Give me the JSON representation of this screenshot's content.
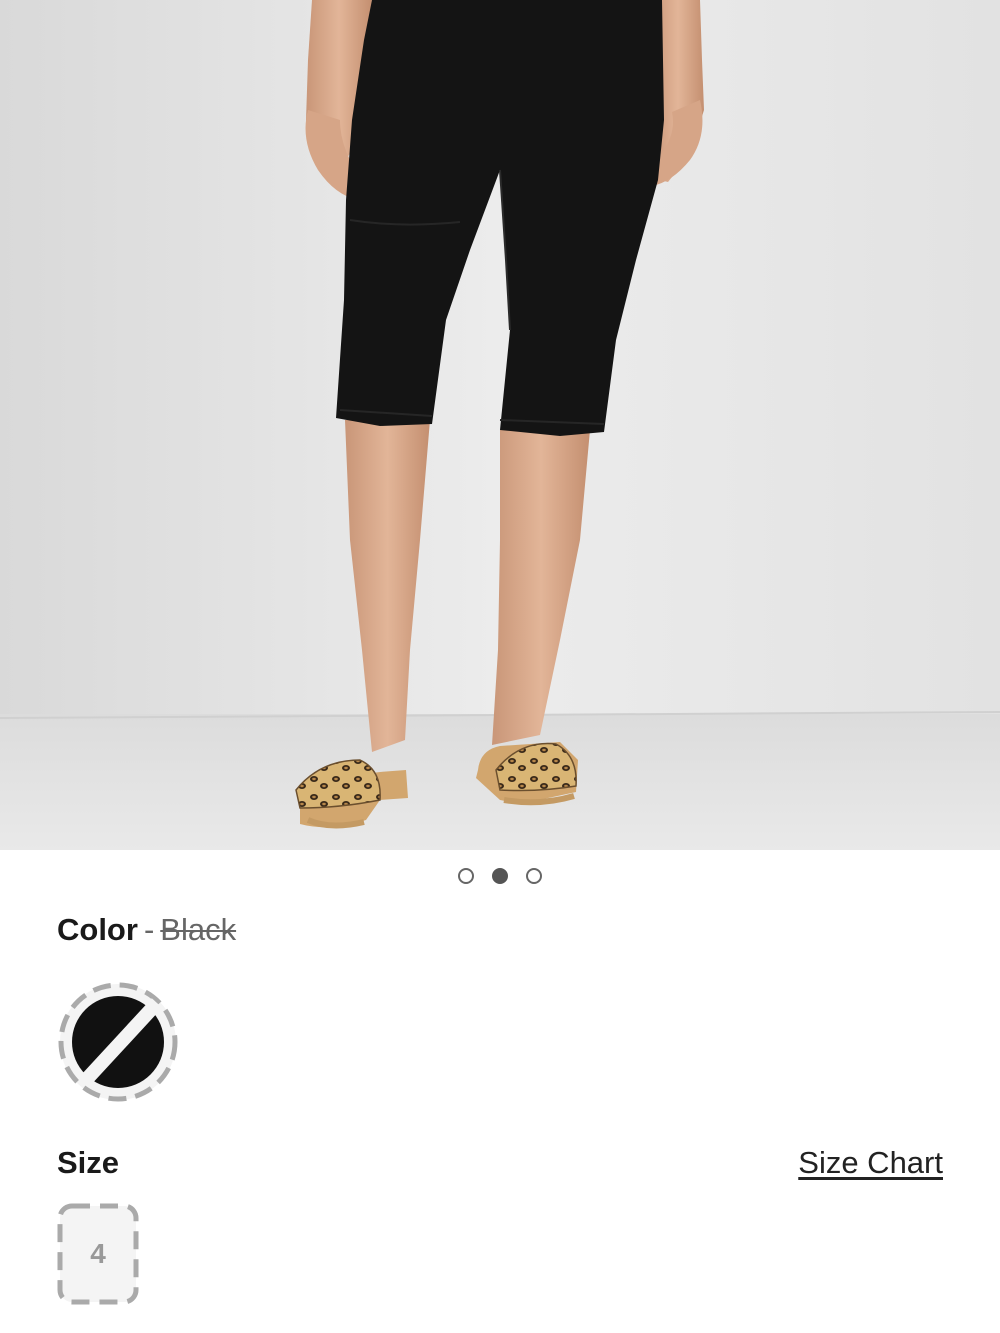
{
  "product_image": {
    "alt": "Woman wearing black capri pants with leopard print sandals"
  },
  "carousel": {
    "dots": [
      {
        "active": false
      },
      {
        "active": true
      },
      {
        "active": false
      }
    ]
  },
  "color": {
    "label": "Color",
    "separator": "-",
    "selected_value": "Black",
    "status": "unavailable",
    "swatch_color": "#111111"
  },
  "size": {
    "label": "Size",
    "chart_link": "Size Chart",
    "options": [
      {
        "label": "4",
        "status": "unavailable"
      }
    ]
  },
  "colors": {
    "text_primary": "#1a1a1a",
    "text_muted": "#666666",
    "disabled_border": "#aaaaaa"
  }
}
